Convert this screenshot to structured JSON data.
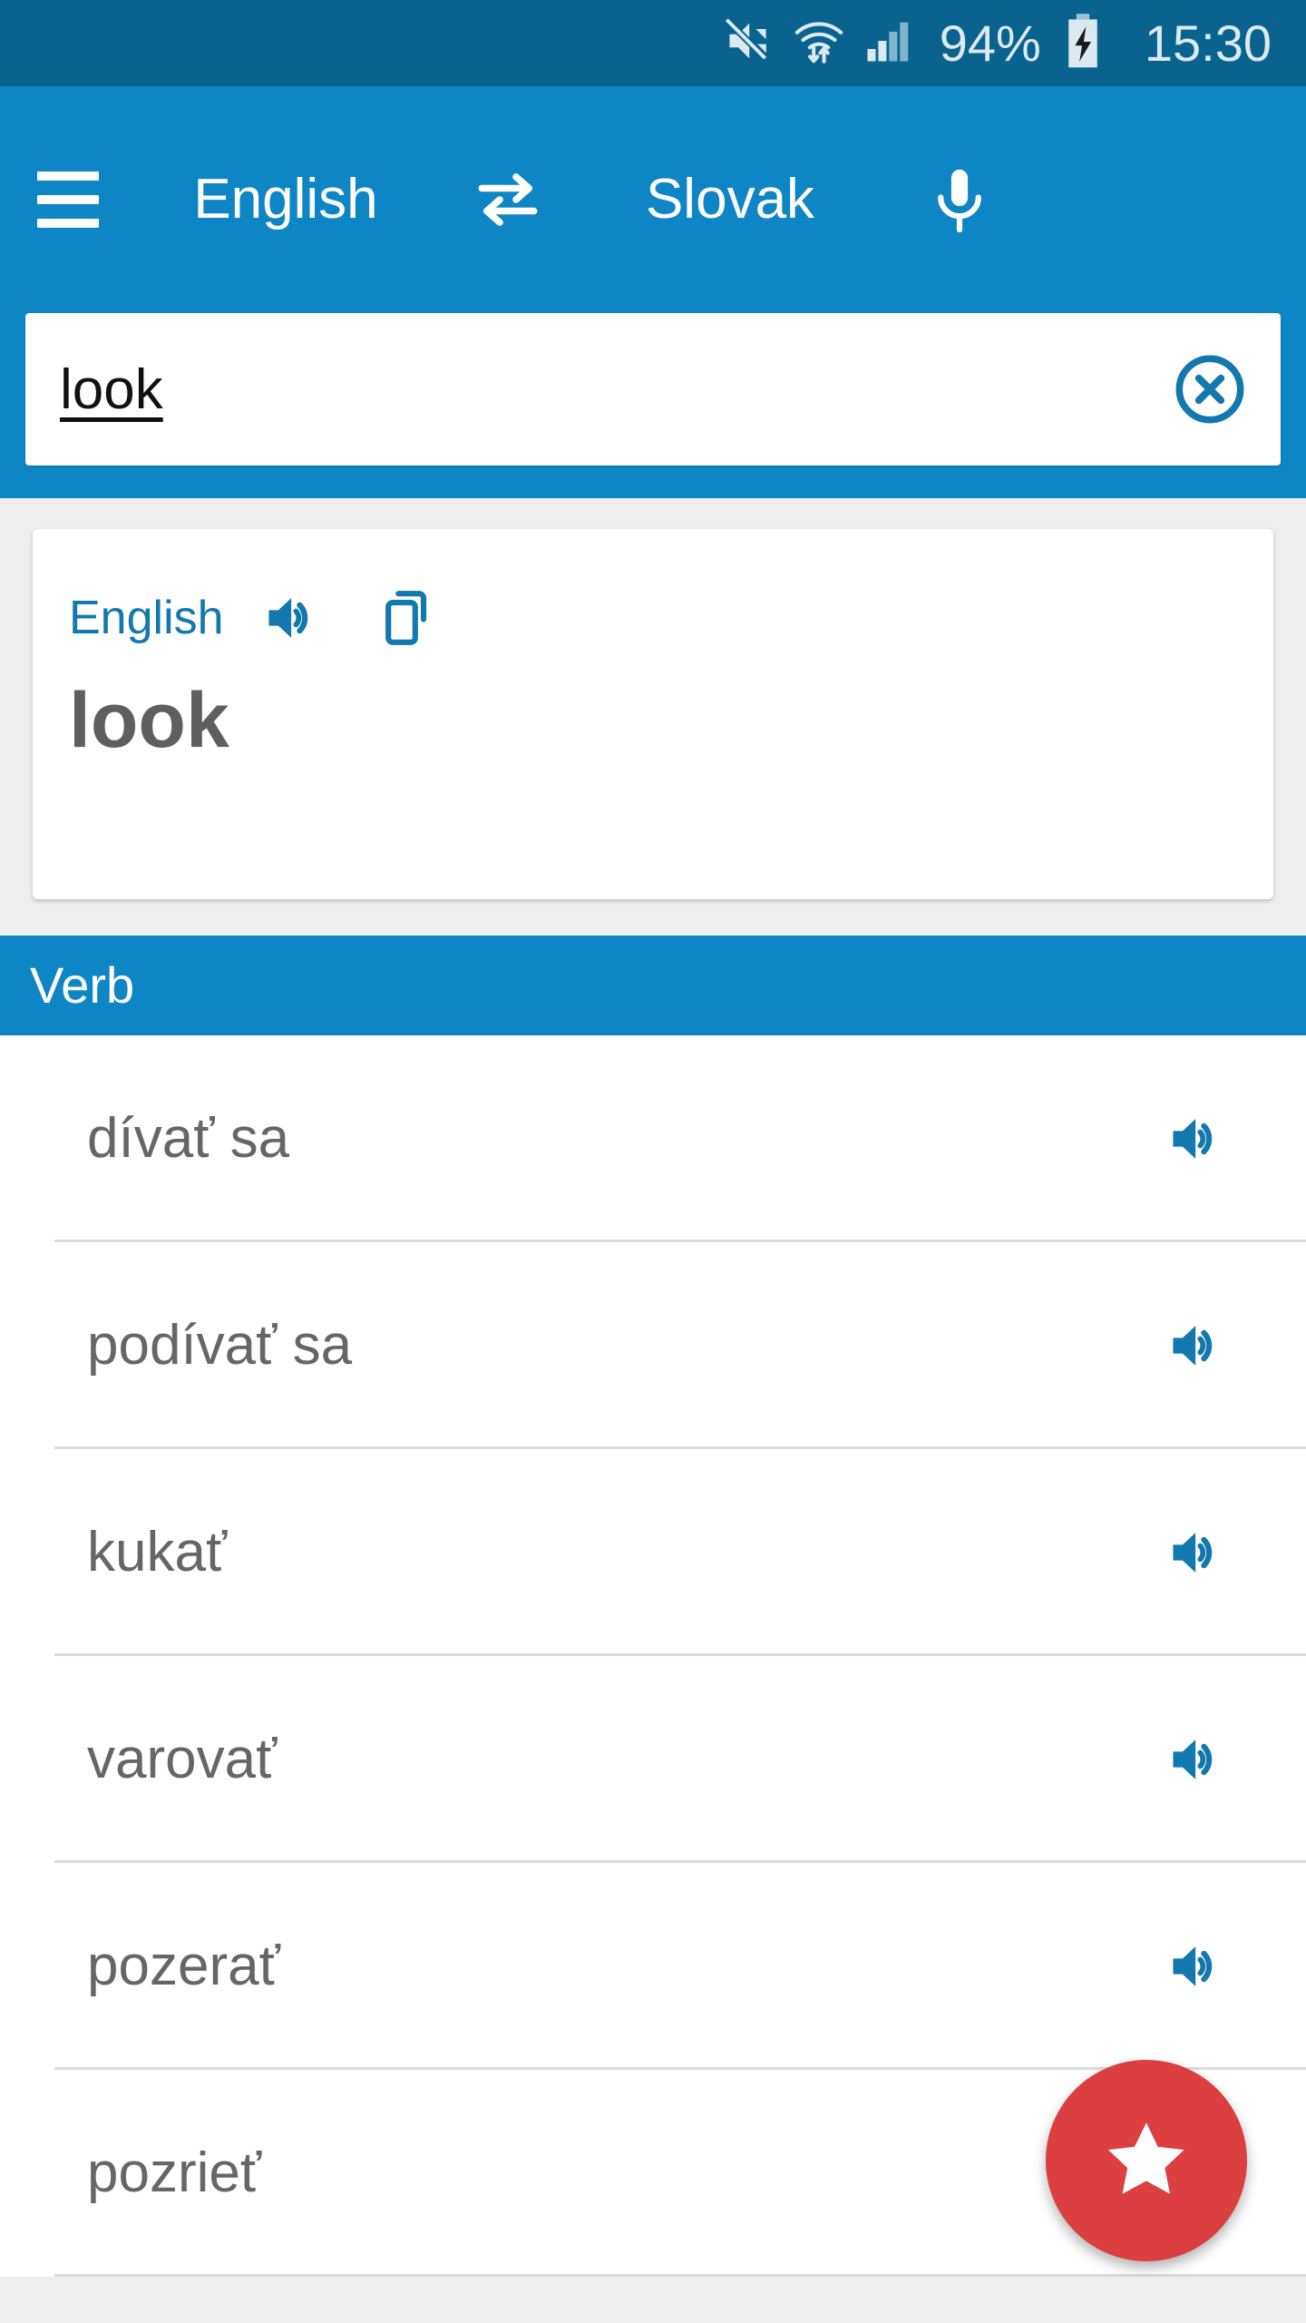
{
  "status_bar": {
    "mute_icon": "mute-icon",
    "wifi_icon": "wifi-transfer-icon",
    "signal_icon": "cellular-signal-icon",
    "battery_percent": "94%",
    "battery_icon": "battery-charging-icon",
    "clock": "15:30",
    "background": "#0a638e",
    "foreground": "#dbe9f1"
  },
  "toolbar": {
    "menu_icon": "hamburger-menu-icon",
    "source_language": "English",
    "swap_icon": "swap-languages-icon",
    "target_language": "Slovak",
    "mic_icon": "microphone-icon",
    "background": "#0e85c4"
  },
  "search": {
    "value": "look",
    "placeholder": "look",
    "clear_icon": "clear-circle-icon"
  },
  "source_card": {
    "language_label": "English",
    "speak_icon": "speaker-icon",
    "copy_icon": "copy-icon",
    "word": "look",
    "accent": "#1278ad",
    "word_color": "#5f5f5f"
  },
  "results": {
    "section_title": "Verb",
    "section_background": "#0e85c4",
    "items": [
      {
        "text": "dívať sa",
        "speak_icon": "speaker-icon"
      },
      {
        "text": "podívať sa",
        "speak_icon": "speaker-icon"
      },
      {
        "text": "kukať",
        "speak_icon": "speaker-icon"
      },
      {
        "text": "varovať",
        "speak_icon": "speaker-icon"
      },
      {
        "text": "pozerať",
        "speak_icon": "speaker-icon"
      },
      {
        "text": "pozrieť",
        "speak_icon": ""
      }
    ]
  },
  "fab": {
    "icon": "star-icon",
    "color": "#db3f3f"
  }
}
